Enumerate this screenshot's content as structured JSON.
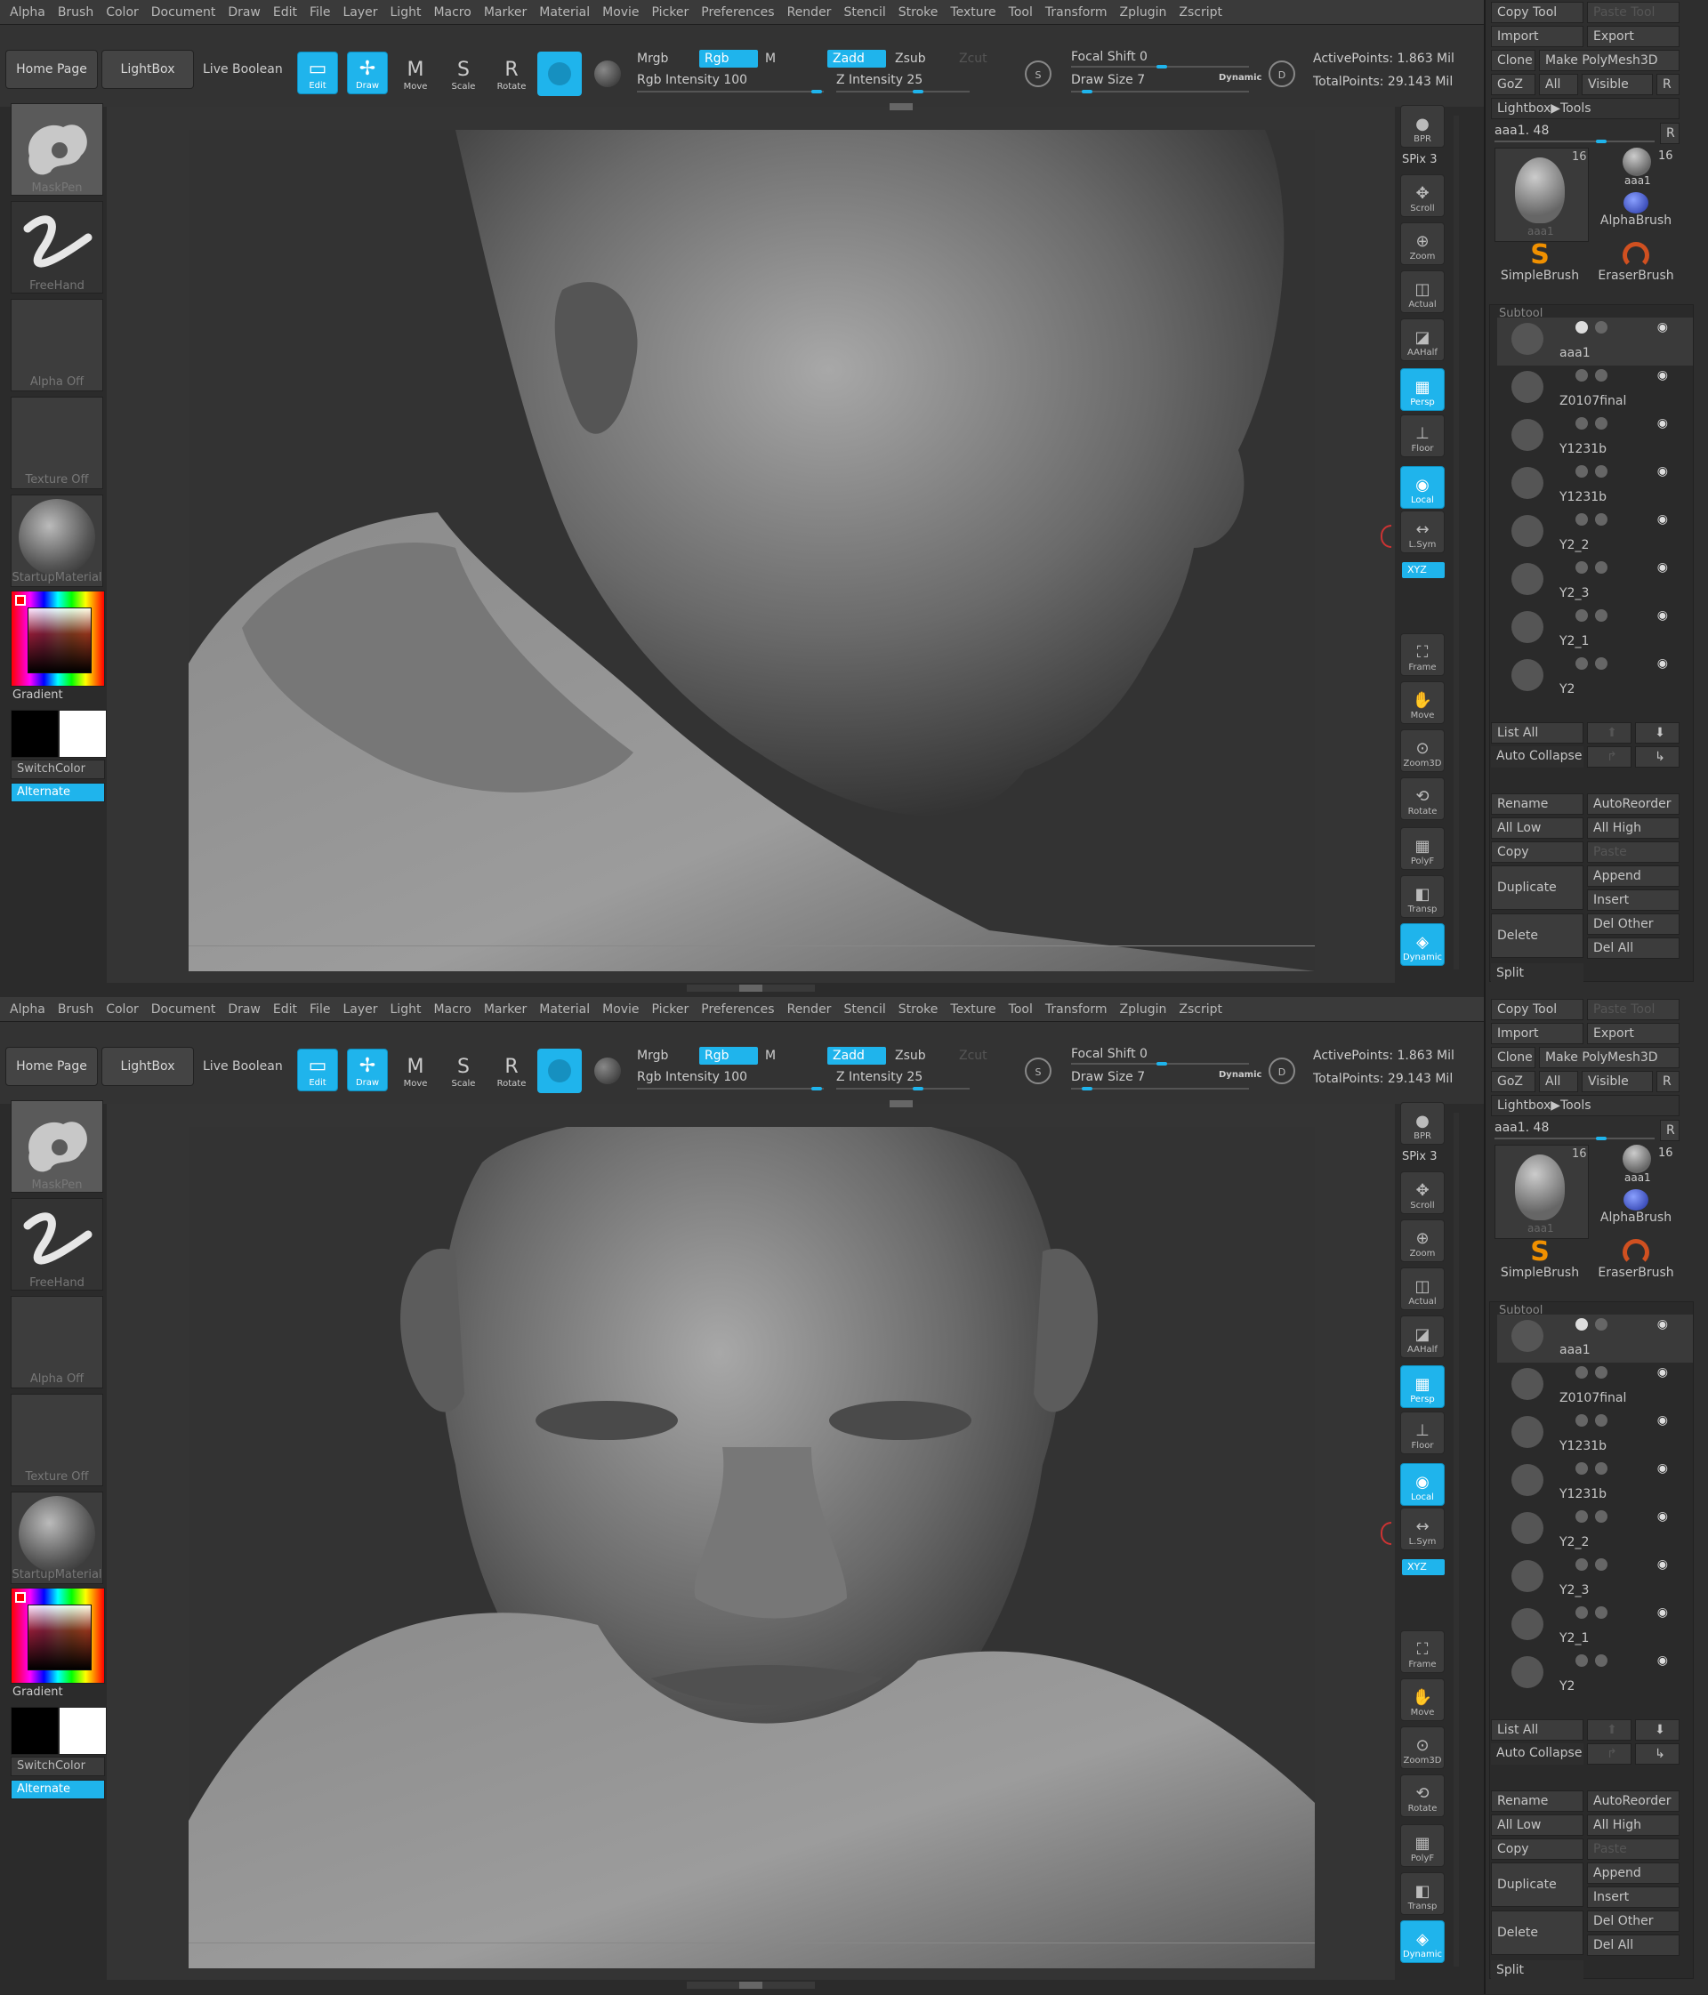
{
  "menu": [
    "Alpha",
    "Brush",
    "Color",
    "Document",
    "Draw",
    "Edit",
    "File",
    "Layer",
    "Light",
    "Macro",
    "Marker",
    "Material",
    "Movie",
    "Picker",
    "Preferences",
    "Render",
    "Stencil",
    "Stroke",
    "Texture",
    "Tool",
    "Transform",
    "Zplugin",
    "Zscript"
  ],
  "shelf": {
    "home_page": "Home Page",
    "lightbox": "LightBox",
    "live_boolean": "Live Boolean",
    "tools": [
      {
        "label": "Edit",
        "icon": "edit-icon",
        "glyph": "▭",
        "active": true
      },
      {
        "label": "Draw",
        "icon": "draw-icon",
        "glyph": "✢",
        "active": true
      },
      {
        "label": "Move",
        "icon": "move-icon",
        "glyph": "M",
        "active": false
      },
      {
        "label": "Scale",
        "icon": "scale-icon",
        "glyph": "S",
        "active": false
      },
      {
        "label": "Rotate",
        "icon": "rotate-icon",
        "glyph": "R",
        "active": false
      }
    ],
    "mrgb": "Mrgb",
    "rgb": "Rgb",
    "m": "M",
    "rgb_intensity": "Rgb Intensity 100",
    "zadd": "Zadd",
    "zsub": "Zsub",
    "zcut": "Zcut",
    "z_intensity": "Z Intensity 25",
    "focal_shift": "Focal Shift 0",
    "draw_size": "Draw Size 7",
    "dynamic": "Dynamic",
    "active_points": "ActivePoints: 1.863 Mil",
    "total_points": "TotalPoints: 29.143 Mil"
  },
  "left": {
    "brush_label": "MaskPen",
    "stroke_label": "FreeHand",
    "alpha_label": "Alpha Off",
    "texture_label": "Texture Off",
    "material_label": "StartupMaterial",
    "gradient": "Gradient",
    "switchcolor": "SwitchColor",
    "alternate": "Alternate"
  },
  "right_strip": [
    {
      "label": "BPR",
      "icon": "bpr-icon",
      "glyph": "●",
      "active": false
    },
    {
      "label": "Scroll",
      "icon": "scroll-icon",
      "glyph": "✥",
      "active": false
    },
    {
      "label": "Zoom",
      "icon": "zoom-icon",
      "glyph": "⊕",
      "active": false
    },
    {
      "label": "Actual",
      "icon": "actual-icon",
      "glyph": "◫",
      "active": false
    },
    {
      "label": "AAHalf",
      "icon": "aahalf-icon",
      "glyph": "◪",
      "active": false
    },
    {
      "label": "Persp",
      "icon": "persp-icon",
      "glyph": "▦",
      "active": true
    },
    {
      "label": "Floor",
      "icon": "floor-icon",
      "glyph": "⊥",
      "active": false
    },
    {
      "label": "Local",
      "icon": "local-icon",
      "glyph": "◉",
      "active": true
    },
    {
      "label": "L.Sym",
      "icon": "lsym-icon",
      "glyph": "↔",
      "active": false
    },
    {
      "label": "Frame",
      "icon": "frame-icon",
      "glyph": "⛶",
      "active": false
    },
    {
      "label": "Move",
      "icon": "move-view-icon",
      "glyph": "✋",
      "active": false
    },
    {
      "label": "Zoom3D",
      "icon": "zoom3d-icon",
      "glyph": "⊙",
      "active": false
    },
    {
      "label": "Rotate",
      "icon": "rotate-view-icon",
      "glyph": "⟲",
      "active": false
    },
    {
      "label": "PolyF",
      "icon": "polyf-icon",
      "glyph": "▦",
      "active": false
    },
    {
      "label": "Transp",
      "icon": "transp-icon",
      "glyph": "◧",
      "active": false
    },
    {
      "label": "Dynamic",
      "icon": "solo-icon",
      "glyph": "◈",
      "active": true
    }
  ],
  "spix": "SPix 3",
  "xyz": "XYZ",
  "tool_panel": {
    "copy_tool": "Copy Tool",
    "paste_tool": "Paste Tool",
    "import": "Import",
    "export": "Export",
    "clone": "Clone",
    "make_polymesh": "Make PolyMesh3D",
    "goz": "GoZ",
    "all": "All",
    "visible": "Visible",
    "r": "R",
    "lightbox_tools": "Lightbox▶Tools",
    "current_tool": "aaa1. 48",
    "tool_count_a": "16",
    "tool_count_b": "16",
    "tool_thumb_a": "aaa1",
    "tool_thumb_b": "aaa1",
    "alphabrush": "AlphaBrush",
    "simplebrush": "SimpleBrush",
    "eraserbrush": "EraserBrush",
    "subtool_header": "Subtool",
    "subtools": [
      "aaa1",
      "Z0107final",
      "Y1231b",
      "Y1231b",
      "Y2_2",
      "Y2_3",
      "Y2_1",
      "Y2"
    ],
    "list_all": "List All",
    "auto_collapse": "Auto Collapse",
    "rename": "Rename",
    "autoreorder": "AutoReorder",
    "all_low": "All Low",
    "all_high": "All High",
    "copy": "Copy",
    "paste": "Paste",
    "duplicate": "Duplicate",
    "append": "Append",
    "insert": "Insert",
    "delete": "Delete",
    "del_other": "Del Other",
    "del_all": "Del All",
    "split": "Split"
  }
}
